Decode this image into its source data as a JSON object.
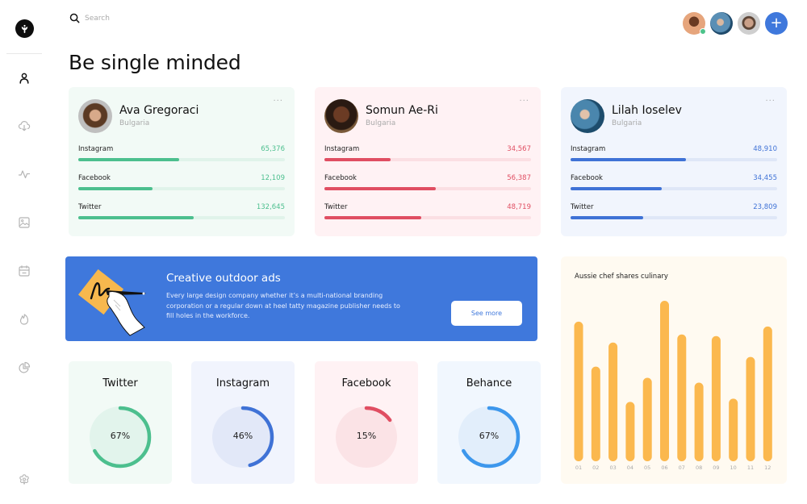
{
  "sidebar": {
    "logo_icon": "leaf-logo-icon",
    "items": [
      {
        "name": "user",
        "icon": "user-icon",
        "active": true
      },
      {
        "name": "cloud-download",
        "icon": "cloud-download-icon",
        "active": false
      },
      {
        "name": "activity",
        "icon": "activity-icon",
        "active": false
      },
      {
        "name": "image",
        "icon": "image-icon",
        "active": false
      },
      {
        "name": "calendar",
        "icon": "calendar-icon",
        "active": false
      },
      {
        "name": "fire",
        "icon": "fire-icon",
        "active": false
      },
      {
        "name": "pie-chart",
        "icon": "pie-chart-icon",
        "active": false
      }
    ],
    "settings_icon": "settings-flower-icon"
  },
  "search": {
    "placeholder": "Search",
    "value": ""
  },
  "header": {
    "avatars": [
      {
        "name": "user-avatar-1",
        "online": true
      },
      {
        "name": "user-avatar-2",
        "online": false
      },
      {
        "name": "user-avatar-3",
        "online": false
      }
    ],
    "add_label": "+"
  },
  "page": {
    "title": "Be single minded"
  },
  "users": [
    {
      "name": "Ava Gregoraci",
      "country": "Bulgaria",
      "more": "···",
      "theme": {
        "bg": "#f2faf6",
        "accent": "#4cbf8e",
        "track": "#e0f3ea"
      },
      "stats": [
        {
          "label": "Instagram",
          "value": "65,376",
          "fraction": 0.49
        },
        {
          "label": "Facebook",
          "value": "12,109",
          "fraction": 0.36
        },
        {
          "label": "Twitter",
          "value": "132,645",
          "fraction": 0.56
        }
      ]
    },
    {
      "name": "Somun Ae-Ri",
      "country": "Bulgaria",
      "more": "···",
      "theme": {
        "bg": "#fff2f4",
        "accent": "#e04e62",
        "track": "#fbdfe3"
      },
      "stats": [
        {
          "label": "Instagram",
          "value": "34,567",
          "fraction": 0.32
        },
        {
          "label": "Facebook",
          "value": "56,387",
          "fraction": 0.54
        },
        {
          "label": "Twitter",
          "value": "48,719",
          "fraction": 0.47
        }
      ]
    },
    {
      "name": "Lilah Ioselev",
      "country": "Bulgaria",
      "more": "···",
      "theme": {
        "bg": "#f1f5fd",
        "accent": "#3f72d6",
        "track": "#dfe7f7"
      },
      "stats": [
        {
          "label": "Instagram",
          "value": "48,910",
          "fraction": 0.56
        },
        {
          "label": "Facebook",
          "value": "34,455",
          "fraction": 0.44
        },
        {
          "label": "Twitter",
          "value": "23,809",
          "fraction": 0.35
        }
      ]
    }
  ],
  "banner": {
    "title": "Creative outdoor ads",
    "text": "Every large design company whether it’s a multi-national branding corporation or a regular down at heel tatty magazine publisher needs to fill holes in the workforce.",
    "button": "See more",
    "bg": "#3f78dc",
    "illustration": "hand-signing-paper-icon"
  },
  "donuts": [
    {
      "title": "Twitter",
      "percent": 67,
      "label": "67%",
      "bg": "#f2faf6",
      "fill": "#e2f4ec",
      "accent": "#4cbf8e"
    },
    {
      "title": "Instagram",
      "percent": 46,
      "label": "46%",
      "bg": "#f1f4fd",
      "fill": "#e2e8f8",
      "accent": "#3f72d6"
    },
    {
      "title": "Facebook",
      "percent": 15,
      "label": "15%",
      "bg": "#fff2f4",
      "fill": "#fbe3e6",
      "accent": "#e04e62"
    },
    {
      "title": "Behance",
      "percent": 67,
      "label": "67%",
      "bg": "#f1f7fe",
      "fill": "#e2eefb",
      "accent": "#3d97ec"
    }
  ],
  "chart_data": {
    "type": "bar",
    "title": "Aussie chef shares culinary",
    "categories": [
      "01",
      "02",
      "03",
      "04",
      "05",
      "06",
      "07",
      "08",
      "09",
      "10",
      "11",
      "12"
    ],
    "values": [
      87,
      59,
      74,
      37,
      52,
      100,
      79,
      49,
      78,
      39,
      65,
      84
    ],
    "xlabel": "",
    "ylabel": "",
    "ylim": [
      0,
      100
    ],
    "grid": false,
    "color": "#fbb84e"
  }
}
